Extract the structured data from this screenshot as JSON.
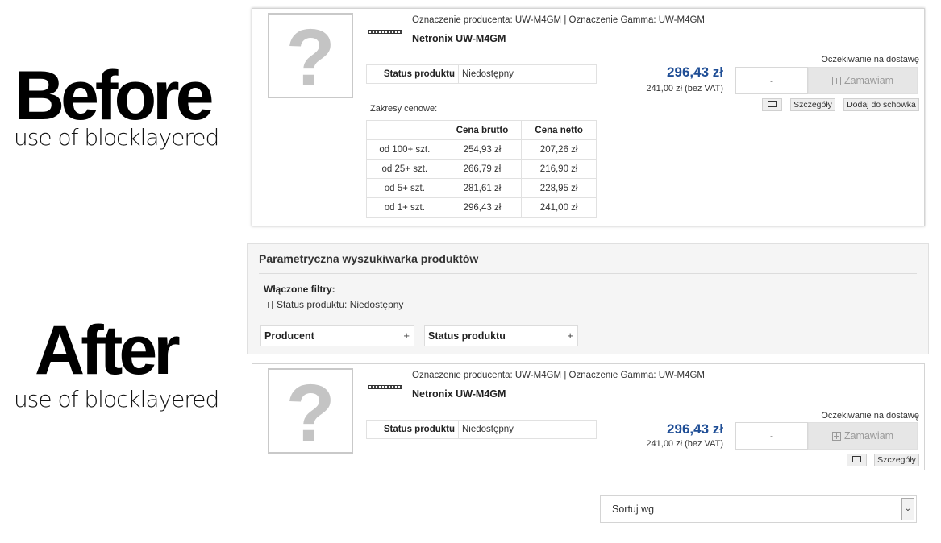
{
  "labels": {
    "before_title": "Before",
    "before_sub": "use of blocklayered",
    "after_title": "After",
    "after_sub": "use of blocklayered"
  },
  "product_before": {
    "placeholder_glyph": "?",
    "codes": "Oznaczenie producenta: UW-M4GM | Oznaczenie Gamma: UW-M4GM",
    "name": "Netronix UW-M4GM",
    "status_label": "Status produktu",
    "status_value": "Niedostępny",
    "ranges_label": "Zakresy cenowe:",
    "table_headers": [
      "",
      "Cena brutto",
      "Cena netto"
    ],
    "table_rows": [
      [
        "od 100+ szt.",
        "254,93 zł",
        "207,26 zł"
      ],
      [
        "od 25+ szt.",
        "266,79 zł",
        "216,90 zł"
      ],
      [
        "od 5+ szt.",
        "281,61 zł",
        "228,95 zł"
      ],
      [
        "od 1+ szt.",
        "296,43 zł",
        "241,00 zł"
      ]
    ],
    "price": "296,43 zł",
    "price_netto": "241,00 zł (bez VAT)",
    "availability": "Oczekiwanie na dostawę",
    "qty_value": "-",
    "order_label": "Zamawiam",
    "details_label": "Szczegóły",
    "clipboard_label": "Dodaj do schowka"
  },
  "filter_panel": {
    "title": "Parametryczna wyszukiwarka produktów",
    "enabled_label": "Włączone filtry:",
    "active_filter": "Status produktu: Niedostępny",
    "accordions": [
      "Producent",
      "Status produktu"
    ],
    "plus": "+"
  },
  "product_after": {
    "placeholder_glyph": "?",
    "codes": "Oznaczenie producenta: UW-M4GM | Oznaczenie Gamma: UW-M4GM",
    "name": "Netronix UW-M4GM",
    "status_label": "Status produktu",
    "status_value": "Niedostępny",
    "price": "296,43 zł",
    "price_netto": "241,00 zł (bez VAT)",
    "availability": "Oczekiwanie na dostawę",
    "qty_value": "-",
    "order_label": "Zamawiam",
    "details_label": "Szczegóły"
  },
  "sort": {
    "label": "Sortuj wg",
    "arrow": "⌄"
  },
  "colors": {
    "price": "#1f4e96",
    "panel_bg": "#f5f5f5",
    "disabled_button": "#e6e6e6"
  }
}
